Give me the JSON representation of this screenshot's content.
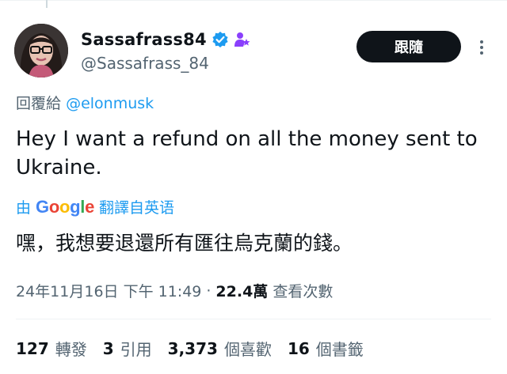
{
  "user": {
    "display_name": "Sassafrass84",
    "handle": "@Sassafrass_84",
    "verified_icon": "verified-badge-icon",
    "affiliate_icon": "person-star-icon"
  },
  "follow_label": "跟隨",
  "reply": {
    "prefix": "回覆給",
    "mention": "@elonmusk"
  },
  "tweet_text": "Hey I want a refund on all the money sent to Ukraine.",
  "translation": {
    "prefix": "由",
    "provider": "Google",
    "suffix": "翻譯自英语",
    "text": "嘿，我想要退還所有匯往烏克蘭的錢。"
  },
  "meta": {
    "timestamp": "24年11月16日 下午 11:49",
    "separator": "·",
    "views_count": "22.4萬",
    "views_label": "查看次數"
  },
  "stats": [
    {
      "count": "127",
      "label": "轉發"
    },
    {
      "count": "3",
      "label": "引用"
    },
    {
      "count": "3,373",
      "label": "個喜歡"
    },
    {
      "count": "16",
      "label": "個書籤"
    }
  ],
  "colors": {
    "accent": "#1d9bf0",
    "text": "#0f1419",
    "muted": "#536471",
    "affiliate": "#8a3ffc"
  }
}
